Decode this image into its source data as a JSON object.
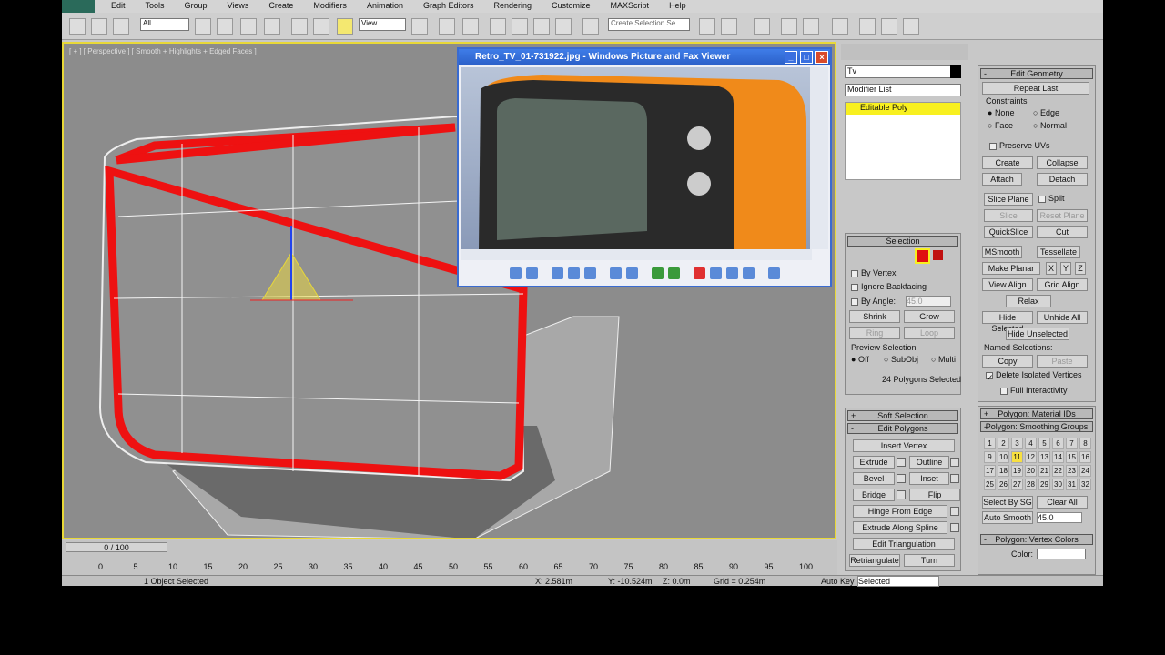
{
  "menu": [
    "Edit",
    "Tools",
    "Group",
    "Views",
    "Create",
    "Modifiers",
    "Animation",
    "Graph Editors",
    "Rendering",
    "Customize",
    "MAXScript",
    "Help"
  ],
  "toolbar": {
    "filter": "All",
    "coord": "View",
    "named_selection": "Create Selection Se"
  },
  "viewport": {
    "label": "[ + ] [ Perspective ] [ Smooth + Highlights + Edged Faces ]",
    "selection_color": "#ee1111",
    "border_color": "#e8d838"
  },
  "viewer": {
    "title": "Retro_TV_01-731922.jpg - Windows Picture and Fax Viewer",
    "body_color": "#f08a1a"
  },
  "command_panel": {
    "object_name": "Tv",
    "object_color": "#000000",
    "modifier_list": "Modifier List",
    "stack_item": "Editable Poly",
    "selection": {
      "title": "Selection",
      "by_vertex": "By Vertex",
      "ignore_backfacing": "Ignore Backfacing",
      "by_angle": "By Angle:",
      "angle": "45.0",
      "shrink": "Shrink",
      "grow": "Grow",
      "ring": "Ring",
      "loop": "Loop",
      "preview": "Preview Selection",
      "off": "Off",
      "subobj": "SubObj",
      "multi": "Multi",
      "status": "24 Polygons Selected"
    },
    "soft_selection": "Soft Selection",
    "edit_polygons": {
      "title": "Edit Polygons",
      "insert_vertex": "Insert Vertex",
      "extrude": "Extrude",
      "outline": "Outline",
      "bevel": "Bevel",
      "inset": "Inset",
      "bridge": "Bridge",
      "flip": "Flip",
      "hinge": "Hinge From Edge",
      "extrude_spline": "Extrude Along Spline",
      "edit_tri": "Edit Triangulation",
      "retriangulate": "Retriangulate",
      "turn": "Turn"
    },
    "edit_geometry": {
      "title": "Edit Geometry",
      "repeat_last": "Repeat Last",
      "constraints": "Constraints",
      "none": "None",
      "edge": "Edge",
      "face": "Face",
      "normal": "Normal",
      "preserve_uvs": "Preserve UVs",
      "create": "Create",
      "collapse": "Collapse",
      "attach": "Attach",
      "detach": "Detach",
      "slice_plane": "Slice Plane",
      "split": "Split",
      "slice": "Slice",
      "reset_plane": "Reset Plane",
      "quickslice": "QuickSlice",
      "cut": "Cut",
      "msmooth": "MSmooth",
      "tessellate": "Tessellate",
      "make_planar": "Make Planar",
      "x": "X",
      "y": "Y",
      "z": "Z",
      "view_align": "View Align",
      "grid_align": "Grid Align",
      "relax": "Relax",
      "hide_selected": "Hide Selected",
      "unhide_all": "Unhide All",
      "hide_unselected": "Hide Unselected",
      "named_selections": "Named Selections:",
      "copy": "Copy",
      "paste": "Paste",
      "delete_isolated": "Delete Isolated Vertices",
      "full_interactivity": "Full Interactivity"
    },
    "material_ids": "Polygon: Material IDs",
    "smoothing": {
      "title": "Polygon: Smoothing Groups",
      "active": 11,
      "select_by_sg": "Select By SG",
      "clear_all": "Clear All",
      "auto_smooth": "Auto Smooth",
      "threshold": "45.0"
    },
    "vertex_colors": {
      "title": "Polygon: Vertex Colors",
      "color": "Color:"
    }
  },
  "timeline": {
    "frame": "0 / 100",
    "ticks": [
      "0",
      "5",
      "10",
      "15",
      "20",
      "25",
      "30",
      "35",
      "40",
      "45",
      "50",
      "55",
      "60",
      "65",
      "70",
      "75",
      "80",
      "85",
      "90",
      "95",
      "100"
    ]
  },
  "status": {
    "selected": "1 Object Selected",
    "x": "2.581m",
    "y": "-10.524m",
    "z": "0.0m",
    "grid": "Grid = 0.254m",
    "auto_key": "Auto Key",
    "key_mode": "Selected"
  }
}
